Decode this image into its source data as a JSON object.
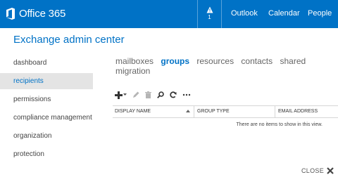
{
  "topbar": {
    "brand": "Office 365",
    "notification_count": "1",
    "links": [
      "Outlook",
      "Calendar",
      "People"
    ],
    "colors": {
      "background": "#0072c6",
      "text": "#ffffff"
    }
  },
  "app_title": "Exchange admin center",
  "sidebar": {
    "items": [
      {
        "label": "dashboard",
        "active": false
      },
      {
        "label": "recipients",
        "active": true
      },
      {
        "label": "permissions",
        "active": false
      },
      {
        "label": "compliance management",
        "active": false
      },
      {
        "label": "organization",
        "active": false
      },
      {
        "label": "protection",
        "active": false
      }
    ]
  },
  "tabs": [
    {
      "label": "mailboxes",
      "active": false
    },
    {
      "label": "groups",
      "active": true
    },
    {
      "label": "resources",
      "active": false
    },
    {
      "label": "contacts",
      "active": false
    },
    {
      "label": "shared",
      "active": false
    },
    {
      "label": "migration",
      "active": false
    }
  ],
  "toolbar": {
    "icons": [
      "add-icon",
      "edit-icon",
      "delete-icon",
      "search-icon",
      "refresh-icon",
      "more-icon"
    ]
  },
  "grid": {
    "columns": [
      "DISPLAY NAME",
      "GROUP TYPE",
      "EMAIL ADDRESS"
    ],
    "empty_message": "There are no items to show in this view."
  },
  "close": {
    "label": "CLOSE"
  }
}
